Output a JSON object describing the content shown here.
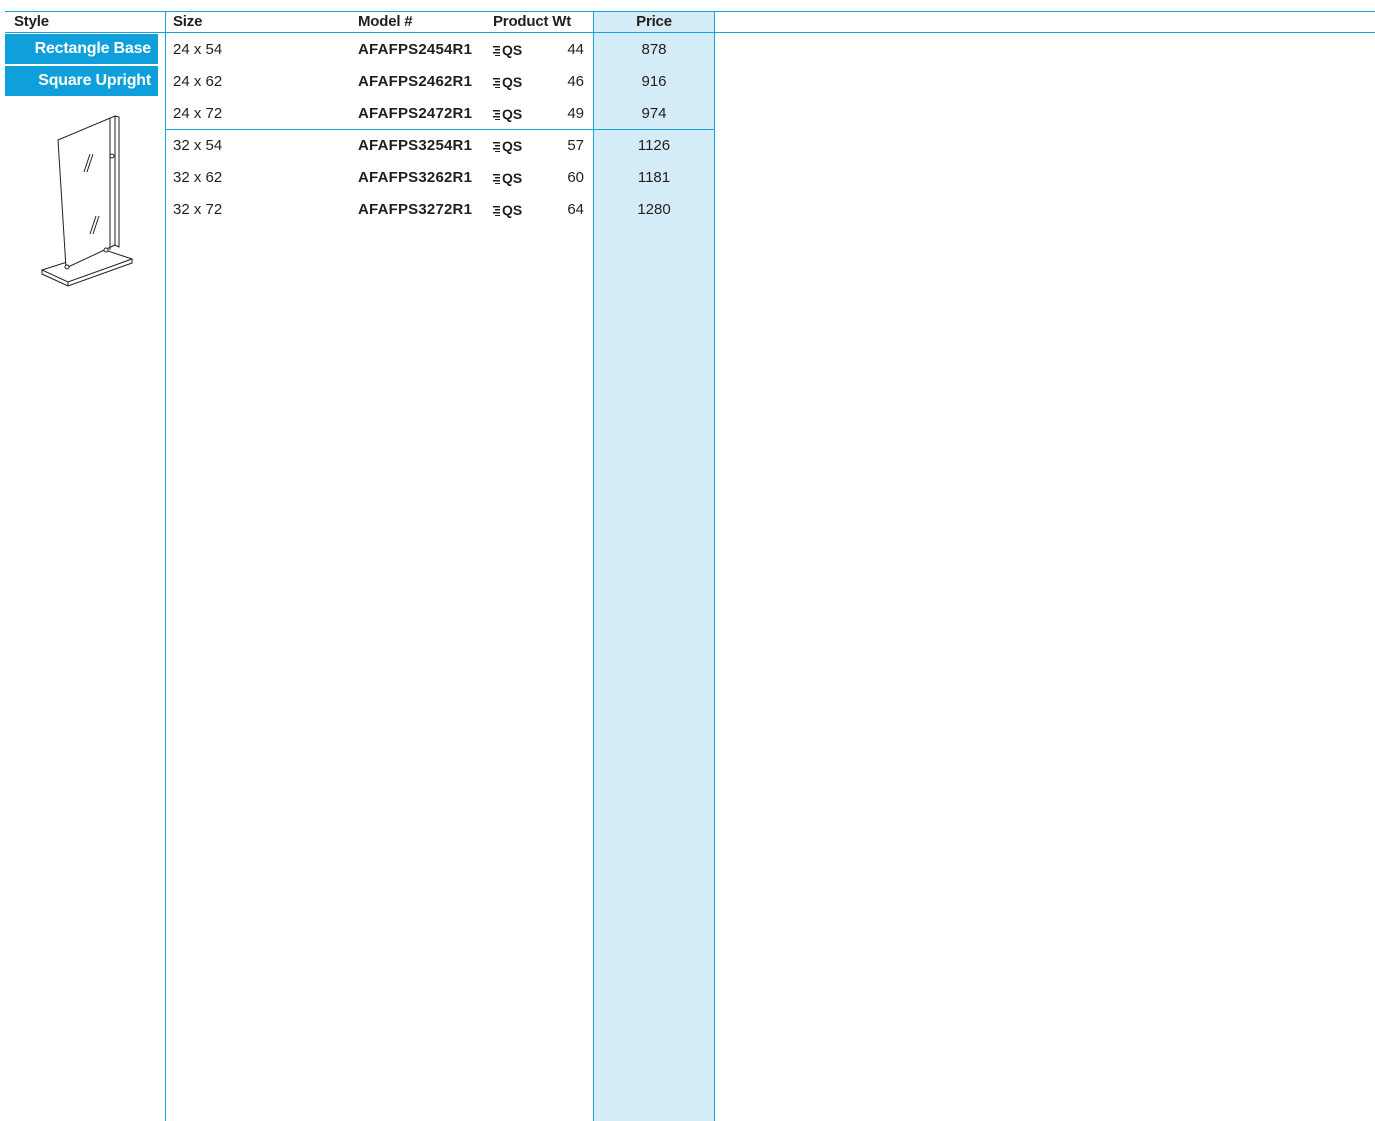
{
  "headers": {
    "style": "Style",
    "size": "Size",
    "model": "Model #",
    "wt": "Product Wt",
    "price": "Price"
  },
  "style_tags": [
    "Rectangle Base",
    "Square Upright"
  ],
  "qs_label": "QS",
  "rows": [
    {
      "size": "24 x 54",
      "model": "AFAFPS2454R1",
      "wt": "44",
      "price": "878"
    },
    {
      "size": "24 x 62",
      "model": "AFAFPS2462R1",
      "wt": "46",
      "price": "916"
    },
    {
      "size": "24 x 72",
      "model": "AFAFPS2472R1",
      "wt": "49",
      "price": "974"
    },
    {
      "size": "32 x 54",
      "model": "AFAFPS3254R1",
      "wt": "57",
      "price": "1126"
    },
    {
      "size": "32 x 62",
      "model": "AFAFPS3262R1",
      "wt": "60",
      "price": "1181"
    },
    {
      "size": "32 x 72",
      "model": "AFAFPS3272R1",
      "wt": "64",
      "price": "1280"
    }
  ],
  "colors": {
    "accent": "#0fa0dc",
    "rule": "#16a3dc",
    "price_band": "#d3ecf7",
    "text": "#231f20"
  }
}
